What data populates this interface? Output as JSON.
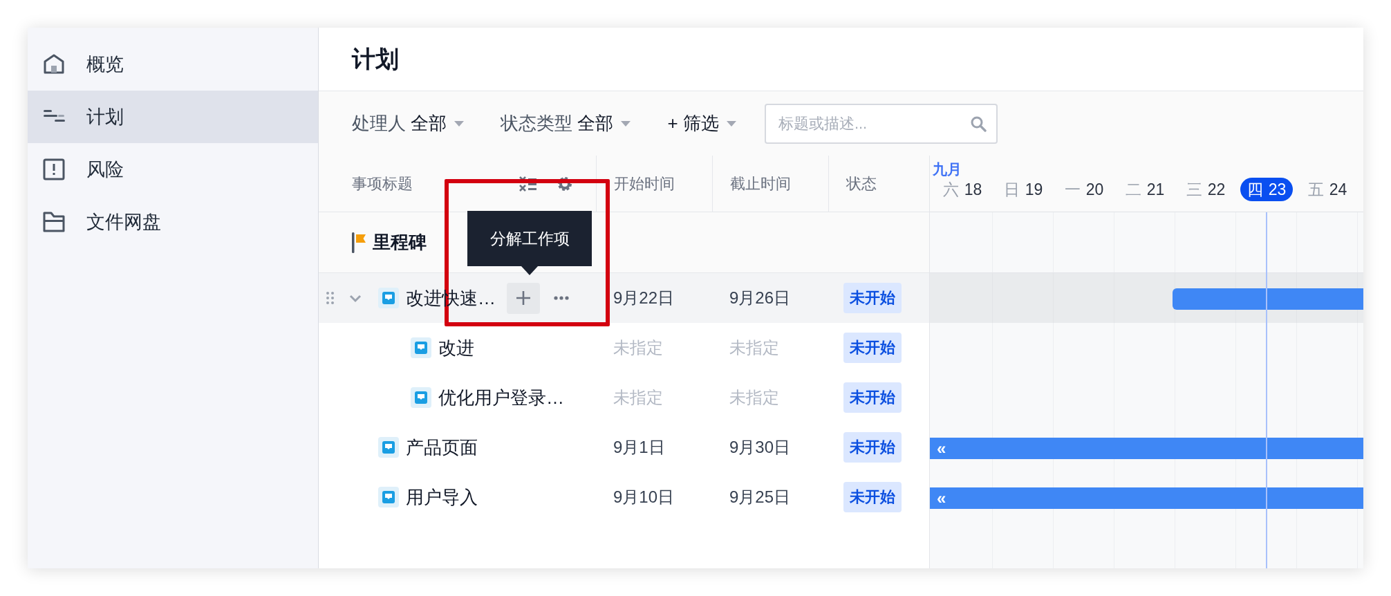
{
  "sidebar": {
    "items": [
      {
        "kind": "home",
        "label": "概览",
        "selected": false
      },
      {
        "kind": "plan",
        "label": "计划",
        "selected": true
      },
      {
        "kind": "risk",
        "label": "风险",
        "selected": false
      },
      {
        "kind": "folder",
        "label": "文件网盘",
        "selected": false
      }
    ]
  },
  "page": {
    "title": "计划"
  },
  "filters": [
    {
      "kind": "select",
      "label": "处理人",
      "value": "全部"
    },
    {
      "kind": "select",
      "label": "状态类型",
      "value": "全部"
    },
    {
      "kind": "add",
      "icon": "+",
      "label": "筛选"
    }
  ],
  "search": {
    "placeholder": "标题或描述..."
  },
  "table": {
    "columns": [
      {
        "kind": "title",
        "label": "事项标题"
      },
      {
        "kind": "date",
        "label": "开始时间"
      },
      {
        "kind": "date",
        "label": "截止时间"
      },
      {
        "kind": "status",
        "label": "状态"
      }
    ],
    "milestone": {
      "label": "里程碑"
    },
    "rows": [
      {
        "title": "改进快速…",
        "start": "9月22日",
        "end": "9月26日",
        "start_set": true,
        "end_set": true,
        "status": "未开始",
        "hovered": true,
        "expanded": true,
        "tooltip": "分解工作项",
        "level": 0.44,
        "children": [
          {
            "title": "改进",
            "start": "未指定",
            "end": "未指定",
            "start_set": false,
            "end_set": false,
            "status": "未开始",
            "hovered": false
          },
          {
            "title": "优化用户登录…",
            "start": "未指定",
            "end": "未指定",
            "start_set": false,
            "end_set": false,
            "status": "未开始",
            "hovered": false
          }
        ]
      },
      {
        "title": "产品页面",
        "start": "9月1日",
        "end": "9月30日",
        "start_set": true,
        "end_set": true,
        "status": "未开始",
        "hovered": false,
        "left_marker": "«",
        "level": 1
      },
      {
        "title": "用户导入",
        "start": "9月10日",
        "end": "9月25日",
        "start_set": true,
        "end_set": true,
        "status": "未开始",
        "hovered": false,
        "left_marker": "«",
        "level": 1
      }
    ]
  },
  "gantt": {
    "month": "九月",
    "days": [
      {
        "weekday": "六",
        "day": "18",
        "today": false
      },
      {
        "weekday": "日",
        "day": "19",
        "today": false
      },
      {
        "weekday": "一",
        "day": "20",
        "today": false
      },
      {
        "weekday": "二",
        "day": "21",
        "today": false
      },
      {
        "weekday": "三",
        "day": "22",
        "today": false
      },
      {
        "weekday": "四",
        "day": "23",
        "today": true
      },
      {
        "weekday": "五",
        "day": "24",
        "today": false
      }
    ]
  },
  "annotation": {
    "shown": true
  }
}
